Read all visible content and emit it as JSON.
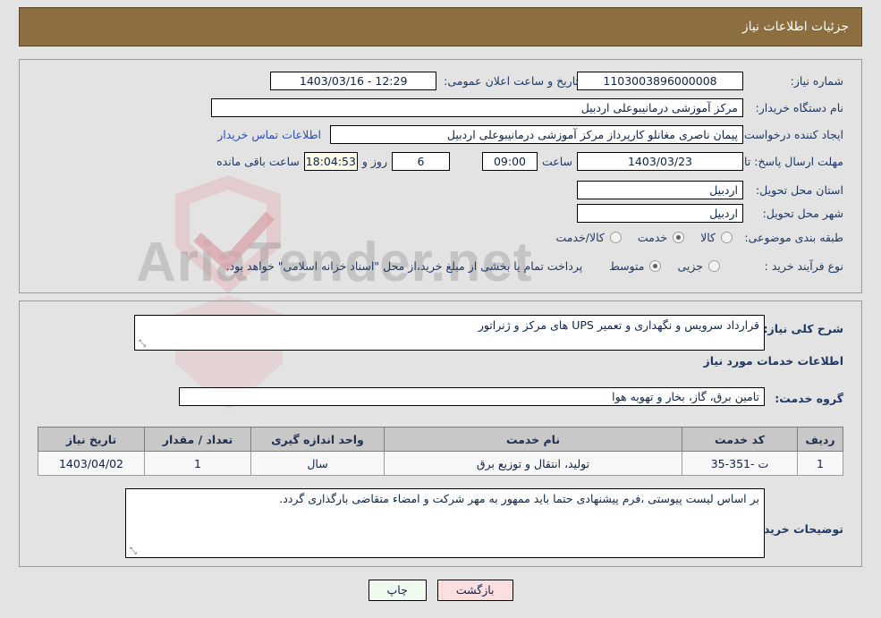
{
  "header": {
    "title": "جزئیات اطلاعات نیاز",
    "bg_color": "#8d6e40"
  },
  "watermark": {
    "text": "AriaTender.net"
  },
  "form": {
    "need_number": {
      "label": "شماره نیاز:",
      "value": "1103003896000008"
    },
    "public_announce": {
      "label": "تاریخ و ساعت اعلان عمومی:",
      "value": "1403/03/16 - 12:29"
    },
    "buyer_org": {
      "label": "نام دستگاه خریدار:",
      "value": "مرکز آموزشی درمانیبوعلی اردبیل"
    },
    "request_creator": {
      "label": "ایجاد کننده درخواست:",
      "value": "پیمان ناصری مغانلو کارپرداز مرکز آموزشی درمانیبوعلی اردبیل"
    },
    "buyer_contact_link": "اطلاعات تماس خریدار",
    "deadline": {
      "label": "مهلت ارسال پاسخ: تا تاریخ:",
      "date": "1403/03/23",
      "time_label": "ساعت",
      "time": "09:00",
      "days": "6",
      "days_label": "روز و",
      "remaining": "18:04:53",
      "remaining_label": "ساعت باقی مانده"
    },
    "delivery_province": {
      "label": "استان محل تحویل:",
      "value": "اردبیل"
    },
    "delivery_city": {
      "label": "شهر محل تحویل:",
      "value": "اردبیل"
    },
    "subject_class": {
      "label": "طبقه بندی موضوعی:",
      "options": [
        {
          "label": "کالا",
          "selected": false
        },
        {
          "label": "خدمت",
          "selected": true
        },
        {
          "label": "کالا/خدمت",
          "selected": false
        }
      ]
    },
    "purchase_type": {
      "label": "نوع فرآیند خرید :",
      "options": [
        {
          "label": "جزیی",
          "selected": false
        },
        {
          "label": "متوسط",
          "selected": true
        }
      ],
      "note": "پرداخت تمام یا بخشی از مبلغ خرید،از محل \"اسناد خزانه اسلامی\" خواهد بود."
    }
  },
  "need_summary": {
    "label": "شرح کلی نیاز:",
    "value": "قرارداد سرویس و نگهداری و تعمیر UPS های مرکز و ژنراتور"
  },
  "services_section": {
    "title": "اطلاعات خدمات مورد نیاز",
    "service_group": {
      "label": "گروه خدمت:",
      "value": "تامین برق، گاز، بخار و تهویه هوا"
    }
  },
  "services_table": {
    "columns": [
      "ردیف",
      "کد خدمت",
      "نام خدمت",
      "واحد اندازه گیری",
      "تعداد / مقدار",
      "تاریخ نیاز"
    ],
    "rows": [
      {
        "row_no": "1",
        "service_code": "ت -351-35",
        "service_name": "تولید، انتقال و توزیع برق",
        "unit": "سال",
        "quantity": "1",
        "need_date": "1403/04/02"
      }
    ]
  },
  "buyer_notes": {
    "label": "توضیحات خریدار:",
    "value": "بر اساس لیست پیوستی ،فرم پیشنهادی حتما باید ممهور به مهر شرکت و امضاء متقاضی بارگذاری گردد."
  },
  "buttons": {
    "print": "چاپ",
    "back": "بازگشت"
  }
}
